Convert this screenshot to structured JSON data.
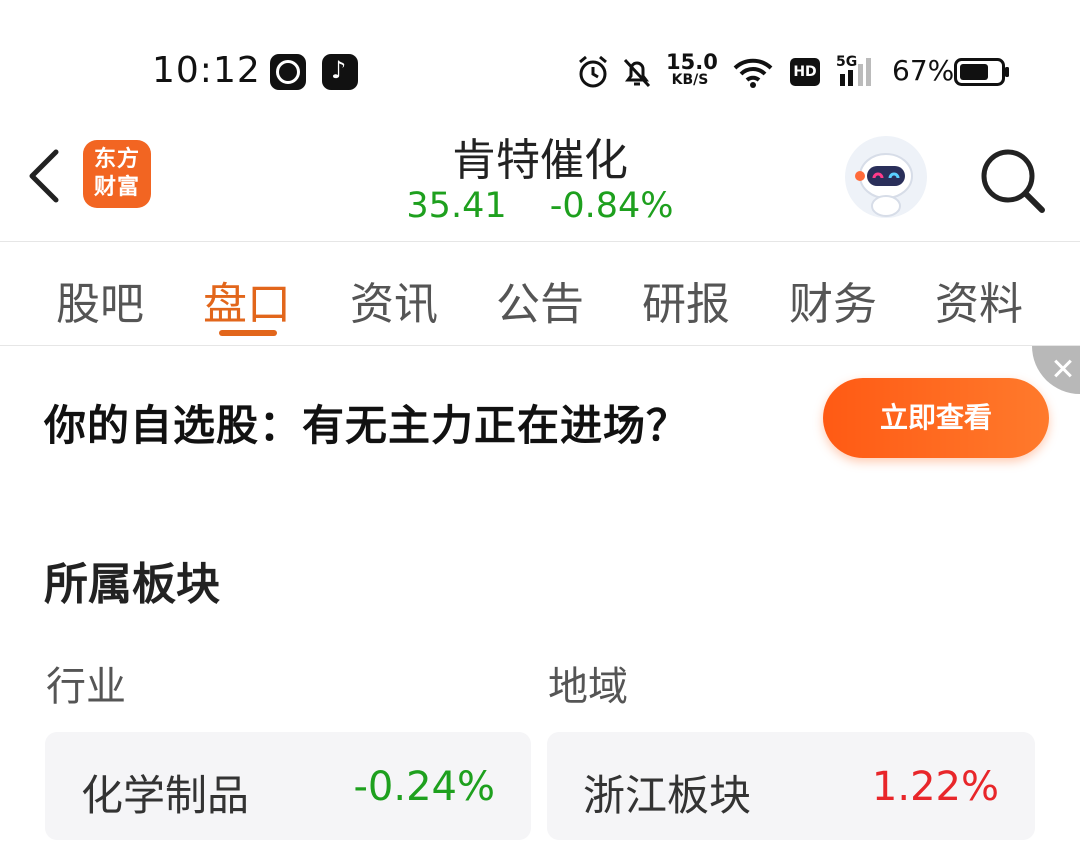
{
  "status_bar": {
    "time": "10:12",
    "net_speed_value": "15.0",
    "net_speed_unit": "KB/S",
    "hd_label": "HD",
    "network_type": "5G",
    "battery_percent": "67%"
  },
  "header": {
    "brand_logo_line1": "东方",
    "brand_logo_line2": "财富",
    "stock_name": "肯特催化",
    "price": "35.41",
    "change_pct": "-0.84%"
  },
  "tabs": [
    {
      "label": "股吧"
    },
    {
      "label": "盘口"
    },
    {
      "label": "资讯"
    },
    {
      "label": "公告"
    },
    {
      "label": "研报"
    },
    {
      "label": "财务"
    },
    {
      "label": "资料"
    }
  ],
  "banner": {
    "text": "你的自选股：有无主力正在进场？",
    "button_label": "立即查看"
  },
  "sectors": {
    "title": "所属板块",
    "industry_label": "行业",
    "region_label": "地域",
    "industry": {
      "name": "化学制品",
      "change": "-0.24%"
    },
    "region": {
      "name": "浙江板块",
      "change": "1.22%"
    }
  },
  "colors": {
    "accent": "#e2661b",
    "down": "#1ea01e",
    "up": "#e8262a",
    "brand": "#f26522"
  }
}
